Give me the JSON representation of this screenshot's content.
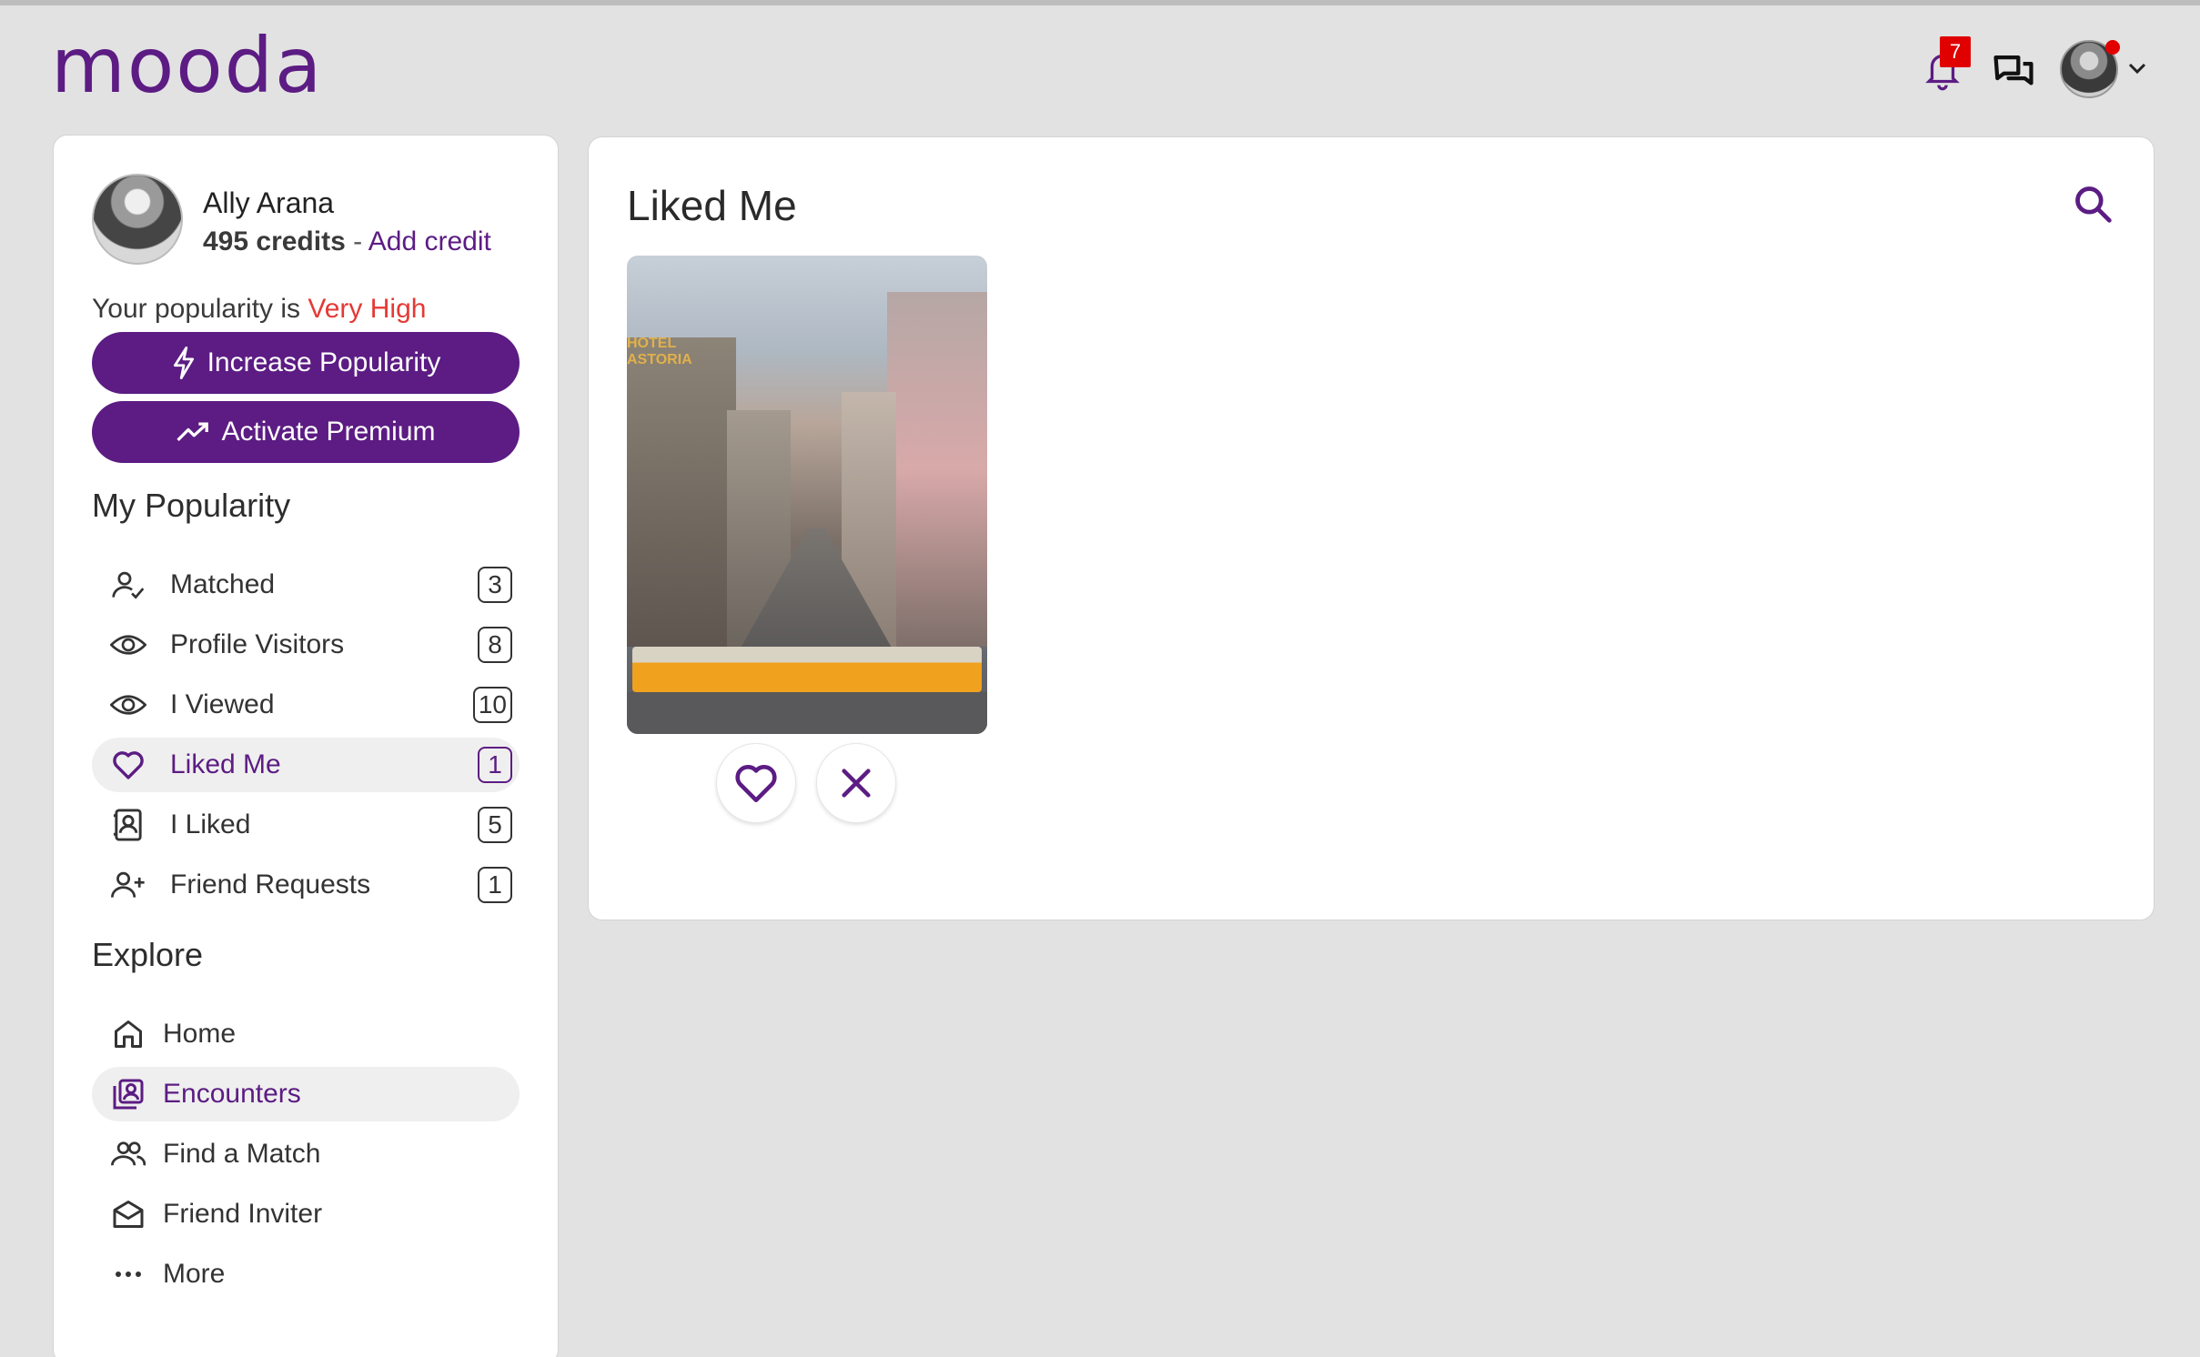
{
  "brand": {
    "logo": "mooda",
    "accent_color": "#5c1c83",
    "alert_color": "#e53935"
  },
  "header": {
    "notifications": {
      "icon": "bell-icon",
      "count": "7"
    },
    "messages": {
      "icon": "chat-icon"
    },
    "account": {
      "icon": "chevron-down-icon",
      "has_alert_dot": true
    }
  },
  "profile": {
    "name": "Ally Arana",
    "credits": "495 credits",
    "separator": " - ",
    "add_credit": "Add credit",
    "popularity_prefix": "Your popularity is",
    "popularity_level": "Very High"
  },
  "buttons": {
    "increase_popularity": "Increase Popularity",
    "activate_premium": "Activate Premium"
  },
  "sidebar": {
    "my_popularity_title": "My Popularity",
    "popularity_items": [
      {
        "label": "Matched",
        "count": "3",
        "icon": "user-check-icon"
      },
      {
        "label": "Profile Visitors",
        "count": "8",
        "icon": "eye-icon"
      },
      {
        "label": "I Viewed",
        "count": "10",
        "icon": "eye-icon"
      },
      {
        "label": "Liked Me",
        "count": "1",
        "icon": "heart-icon",
        "active": true
      },
      {
        "label": "I Liked",
        "count": "5",
        "icon": "contact-card-icon"
      },
      {
        "label": "Friend Requests",
        "count": "1",
        "icon": "user-plus-icon"
      }
    ],
    "explore_title": "Explore",
    "explore_items": [
      {
        "label": "Home",
        "icon": "home-icon"
      },
      {
        "label": "Encounters",
        "icon": "encounters-icon",
        "active": true
      },
      {
        "label": "Find a Match",
        "icon": "users-icon"
      },
      {
        "label": "Friend Inviter",
        "icon": "envelope-icon"
      },
      {
        "label": "More",
        "icon": "more-dots-icon"
      }
    ]
  },
  "main": {
    "title": "Liked Me",
    "search_icon": "search-icon",
    "cards": [
      {
        "photo_sign": "HOTEL ASTORIA",
        "actions": [
          "heart-icon",
          "close-icon"
        ]
      }
    ]
  }
}
